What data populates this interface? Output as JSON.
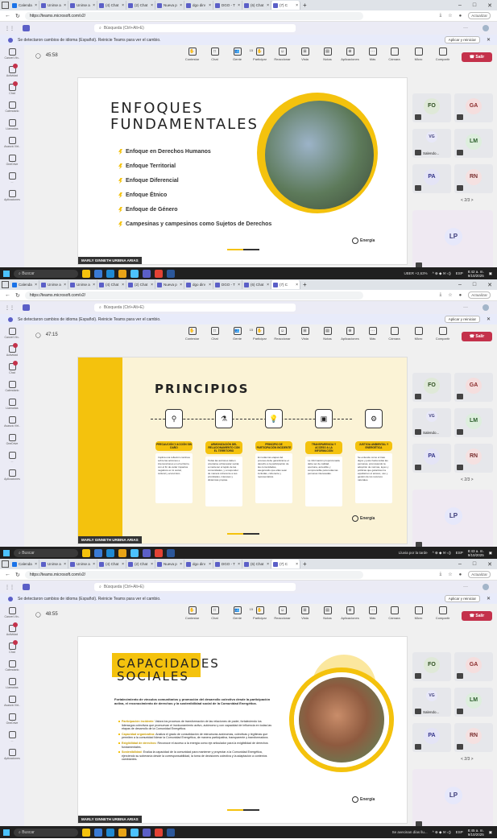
{
  "browser": {
    "tabs": [
      "Calenda",
      "Unirse a",
      "Unirse a",
      "(4) Chat",
      "(2) Chat",
      "Nueva p",
      "dgo dirv",
      "DGO - T",
      "(6) Chat",
      "(7) C"
    ],
    "url": "https://teams.microsoft.com/v2/",
    "update_label": "Actualizar"
  },
  "teams": {
    "search_placeholder": "Búsqueda (Ctrl+Alt+E)",
    "banner_text": "Se detectaron cambios de idioma (Español). Reinicie Teams para ver el cambio.",
    "banner_button": "Aplicar y reiniciar",
    "rail": [
      "Canvet Vin..",
      "Actividad",
      "Chat",
      "Calendario",
      "Llamadas",
      "Avanzá Virt..",
      "OneDrive",
      "...",
      "Aplicaciones"
    ],
    "tools": [
      "Contestar",
      "Chat",
      "Gente",
      "Participar",
      "Reaccionar",
      "Vista",
      "Notas",
      "Aplicaciones",
      "Más"
    ],
    "people_count": "15",
    "tools2": [
      "Cámara",
      "Micro",
      "Compartir"
    ],
    "leave": "Salir",
    "participants": [
      "FO",
      "GA",
      "VG",
      "LM",
      "PA",
      "RN"
    ],
    "salendo": "Salendo...",
    "pager": "2/3",
    "big_tile": "LP",
    "presenter": "MARLY GINNETH URBINA ARIAS",
    "brand": "Energía",
    "colors": {
      "accent": "#f4c20d",
      "teams": "#5b5fc7",
      "leave": "#c4314b"
    }
  },
  "screens": [
    {
      "timer": "45:58",
      "slide_title": "ENFOQUES FUNDAMENTALES",
      "items": [
        "Enfoque en Derechos Humanos",
        "Enfoque Territorial",
        "Enfoque Diferencial",
        "Enfoque Étnico",
        "Enfoque de Género",
        "Campesinas y campesinos como Sujetos de Derechos"
      ],
      "taskbar": {
        "search": "Buscar",
        "weather": "UBER +2,63%",
        "time": "8:42 a. m.",
        "date": "9/10/2025",
        "lang": "ESP"
      }
    },
    {
      "timer": "47:15",
      "slide_title": "PRINCIPIOS",
      "principles": [
        {
          "head": "PRECAUCIÓN Y ACCIÓN SIN DAÑO",
          "body": "Implica una reflexión continua sobre las acciones e intervenciones en el territorio, con el fin de evitar impactos negativos en lo social, cultural y económico."
        },
        {
          "head": "ARMONIZACIÓN DEL RELACIONAMIENTO CON EL TERRITORIO",
          "body": "Todas las acciones deben orientarse al bienestar social, a mantener el tejido de las comunidades, y a responder de manera coherente a sus prioridades, intereses y dinámicas propias."
        },
        {
          "head": "PRINCIPIO DE PARTICIPACIÓN INCIDENTE",
          "body": "En todas las etapas del proceso debe garantizarse el derecho a la participación de las comunidades, asegurando que ellas sean incluidas, coherente y representativa."
        },
        {
          "head": "TRANSPARENCIA Y ACCESO A LA INFORMACIÓN",
          "body": "La información proporcionada debe ser de calidad, oportuna, accesible y comprensible para todas las personas interesadas."
        },
        {
          "head": "JUSTICIA AMBIENTAL Y ENERGÉTICA",
          "body": "Se entiende como el trato digno y justo hacia todas las personas, promoviendo la adopción de normas, leyes y políticas que garanticen la equidad en el acceso, uso y gestión de los recursos naturales."
        }
      ],
      "taskbar": {
        "search": "Buscar",
        "weather": "Lluvia por la tarde",
        "time": "8:43 a. m.",
        "date": "9/10/2025",
        "lang": "ESP"
      }
    },
    {
      "timer": "48:55",
      "slide_title": "CAPACIDADES SOCIALES",
      "intro": "Fortalecimiento de vínculos comunitarios y promoción del desarrollo colectivo desde la participación activa, el reconocimiento de derechos y la sostenibilidad social de la Comunidad Energética.",
      "capacities": [
        {
          "name": "Participación incidente:",
          "text": "Valora los procesos de transformación de las relaciones de poder, fortaleciendo los liderazgos colectivos que promuevan el involucramiento activo, autónomo y con capacidad de influencia en todas las etapas de desarrollo de la Comunidad Energética."
        },
        {
          "name": "Capacidad organizativa:",
          "text": "Analiza el grado de consolidación de estructuras autónomas, colectivas y legítimas que permiten a la comunidad liderar la Comunidad Energética, de manera participativa, transparente y transformadora."
        },
        {
          "name": "Exigibilidad de derechos:",
          "text": "Reconoce el acceso a la energía como eje articulador para la exigibilidad de derechos fundamentales."
        },
        {
          "name": "Sostenibilidad:",
          "text": "Evalúa la capacidad de la comunidad para mantener y proyectar a la Comunidad Energética, ejerciendo su soberanía desde la corresponsabilidad, la toma de decisiones colectiva y la adaptación a contextos cambiantes."
        }
      ],
      "taskbar": {
        "search": "Buscar",
        "weather": "Se avecinan días llu...",
        "time": "8:45 a. m.",
        "date": "9/10/2025",
        "lang": "ESP"
      }
    }
  ]
}
